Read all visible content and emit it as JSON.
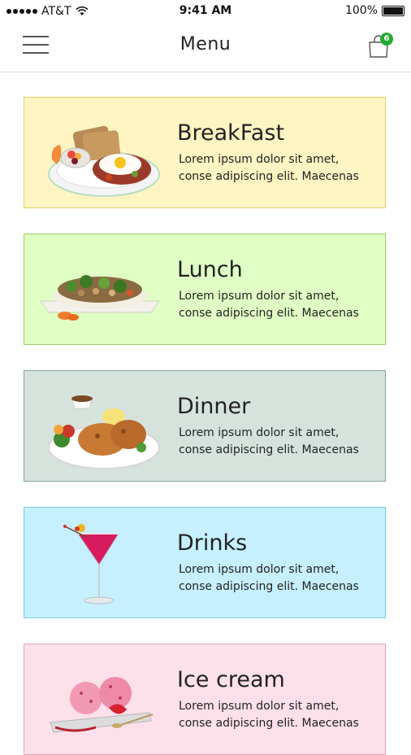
{
  "status_bar": {
    "carrier": "AT&T",
    "time": "9:41 AM",
    "battery": "100%"
  },
  "header": {
    "title": "Menu",
    "cart_count": "6"
  },
  "menu_items": [
    {
      "title": "BreakFast",
      "desc_line1": "Lorem ipsum dolor sit amet,",
      "desc_line2": "conse adipiscing elit. Maecenas",
      "bg": "#fff5c2",
      "border": "#e6cc66"
    },
    {
      "title": "Lunch",
      "desc_line1": "Lorem ipsum dolor sit amet,",
      "desc_line2": "conse adipiscing elit. Maecenas",
      "bg": "#e0ffc4",
      "border": "#9ccf66"
    },
    {
      "title": "Dinner",
      "desc_line1": "Lorem ipsum dolor sit amet,",
      "desc_line2": "conse adipiscing elit. Maecenas",
      "bg": "#d6e3dd",
      "border": "#8aa396"
    },
    {
      "title": "Drinks",
      "desc_line1": "Lorem ipsum dolor sit amet,",
      "desc_line2": "conse adipiscing elit. Maecenas",
      "bg": "#c6f0ff",
      "border": "#7dc9e6"
    },
    {
      "title": "Ice cream",
      "desc_line1": "Lorem ipsum dolor sit amet,",
      "desc_line2": "conse adipiscing elit. Maecenas",
      "bg": "#fde0ea",
      "border": "#e6a6bd"
    }
  ]
}
